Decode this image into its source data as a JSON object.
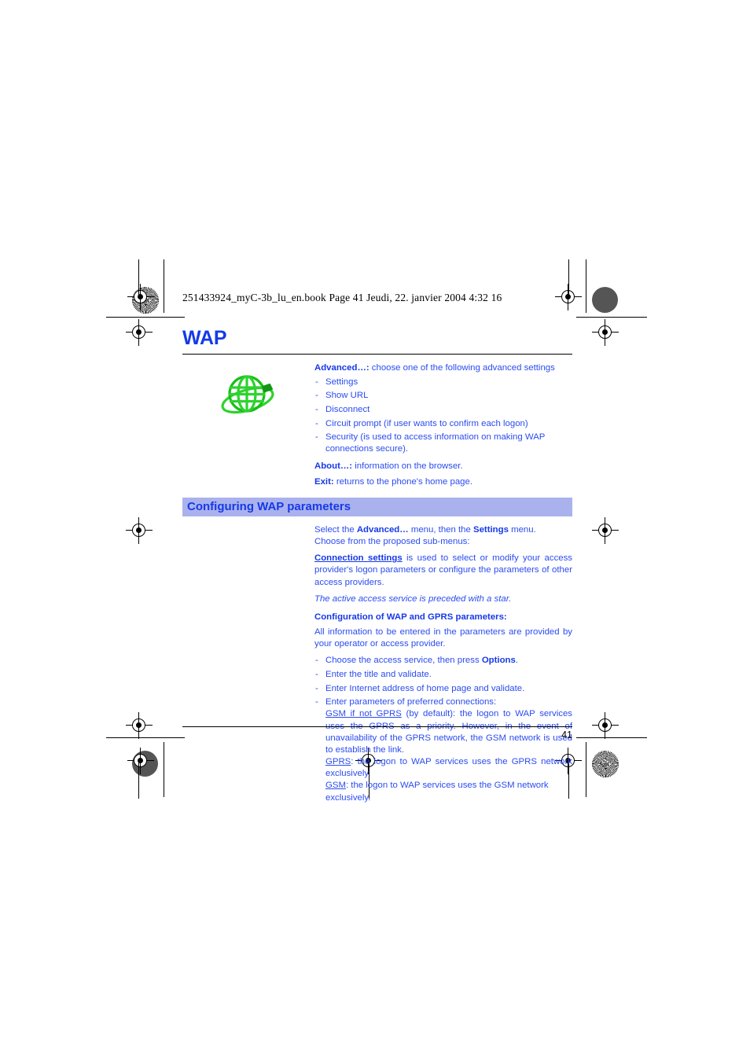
{
  "document": {
    "file_header": "251433924_myC-3b_lu_en.book  Page 41  Jeudi, 22. janvier 2004  4:32 16",
    "chapter_title": "WAP",
    "page_number": "41",
    "colors": {
      "heading_blue": "#1639e8",
      "body_blue": "#2b4cf0",
      "band_background": "#aab2ee",
      "icon_green": "#1fc61f",
      "rule_black": "#000000"
    }
  },
  "icon": {
    "name": "wap-globe-icon",
    "alt": "green wireframe globe with orbit ring"
  },
  "advanced": {
    "lede_bold": "Advanced…:",
    "lede_rest": " choose one of the following advanced settings",
    "dash": "-",
    "items": [
      "Settings",
      "Show URL",
      "Disconnect",
      "Circuit prompt (if user wants to confirm each logon)",
      "Security (is used to access information on making WAP connections secure)."
    ],
    "about_bold": "About…:",
    "about_rest": " information on the browser.",
    "exit_bold": "Exit:",
    "exit_rest": " returns to the phone's home page."
  },
  "section": {
    "title": "Configuring WAP parameters"
  },
  "body": {
    "select_line_1_a": "Select the ",
    "select_line_1_b": "Advanced…",
    "select_line_1_c": " menu, then the ",
    "select_line_1_d": "Settings",
    "select_line_1_e": " menu.",
    "select_line_2": "Choose from the proposed sub-menus:",
    "connection_settings_link": "Connection settings",
    "connection_settings_rest": " is used to select or modify your access provider's logon parameters or configure the parameters of other access providers.",
    "active_service_note": "The active access service is preceded with a star.",
    "config_subhead": "Configuration of WAP and GPRS parameters:",
    "all_info": "All information to be entered in the parameters are provided by your operator or access provider.",
    "dash": "-",
    "steps": [
      {
        "before": "Choose the access service, then press ",
        "bold": "Options",
        "after": "."
      },
      {
        "before": "Enter the title and validate.",
        "bold": "",
        "after": ""
      },
      {
        "before": "Enter Internet address of home page and validate.",
        "bold": "",
        "after": ""
      },
      {
        "before": "Enter parameters of preferred connections:",
        "bold": "",
        "after": ""
      }
    ],
    "connection_modes": [
      {
        "term": "GSM if not GPRS",
        "text": " (by default): the logon to WAP services uses the GPRS as a priority. However, in the event of unavailability of the GPRS network, the GSM network is used to establish the link."
      },
      {
        "term": "GPRS",
        "text": ": the logon to WAP services uses the GPRS network exclusively."
      },
      {
        "term": "GSM",
        "text": ": the logon to WAP services uses the GSM network exclusively."
      }
    ]
  }
}
